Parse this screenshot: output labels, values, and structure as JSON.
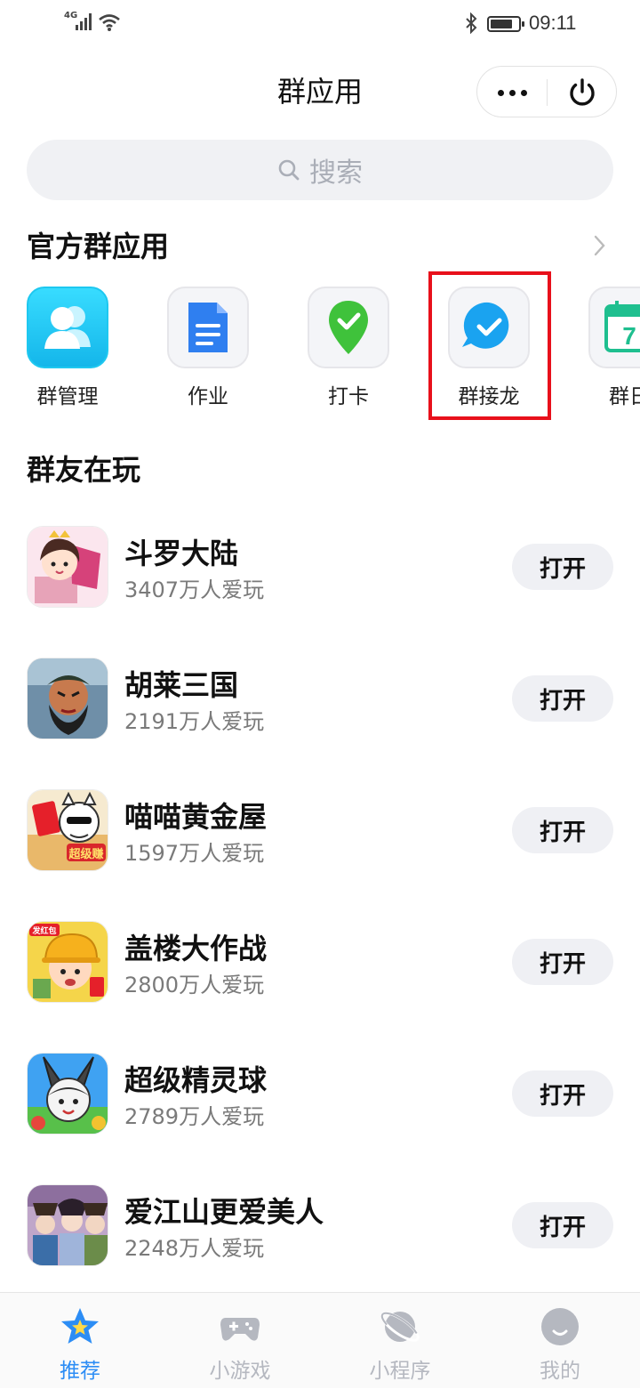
{
  "status_bar": {
    "network": "4G",
    "time": "09:11",
    "battery_level": 0.8
  },
  "header": {
    "title": "群应用"
  },
  "search": {
    "placeholder": "搜索"
  },
  "official": {
    "title": "官方群应用",
    "apps": [
      {
        "label": "群管理",
        "icon": "members-icon",
        "highlighted": false
      },
      {
        "label": "作业",
        "icon": "document-icon",
        "highlighted": false
      },
      {
        "label": "打卡",
        "icon": "location-check-icon",
        "highlighted": false
      },
      {
        "label": "群接龙",
        "icon": "chat-check-icon",
        "highlighted": true
      },
      {
        "label": "群日",
        "icon": "calendar-icon",
        "calendar_day": "7",
        "highlighted": false
      }
    ]
  },
  "friends_playing": {
    "title": "群友在玩",
    "open_label": "打开",
    "games": [
      {
        "name": "斗罗大陆",
        "players": "3407万人爱玩"
      },
      {
        "name": "胡莱三国",
        "players": "2191万人爱玩"
      },
      {
        "name": "喵喵黄金屋",
        "players": "1597万人爱玩",
        "badge": "超级赚"
      },
      {
        "name": "盖楼大作战",
        "players": "2800万人爱玩",
        "badge": "发红包"
      },
      {
        "name": "超级精灵球",
        "players": "2789万人爱玩"
      },
      {
        "name": "爱江山更爱美人",
        "players": "2248万人爱玩"
      }
    ]
  },
  "tabbar": {
    "tabs": [
      {
        "label": "推荐",
        "icon": "star-icon",
        "active": true
      },
      {
        "label": "小游戏",
        "icon": "gamepad-icon",
        "active": false
      },
      {
        "label": "小程序",
        "icon": "planet-icon",
        "active": false
      },
      {
        "label": "我的",
        "icon": "smile-icon",
        "active": false
      }
    ]
  },
  "colors": {
    "accent": "#2c8df5",
    "highlight_border": "#e8101b",
    "button_bg": "#eff0f4",
    "muted_text": "#7a7a7a"
  }
}
